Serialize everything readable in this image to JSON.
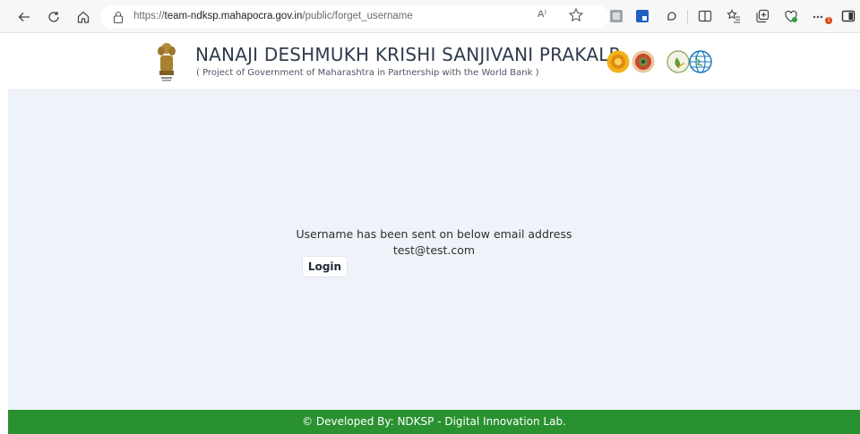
{
  "browser": {
    "url_prefix": "https://",
    "url_host": "team-ndksp.mahapocra.gov.in",
    "url_path": "/public/forget_username",
    "read_aloud": "A⁾",
    "notification_badge": "1"
  },
  "header": {
    "title": "NANAJI DESHMUKH KRISHI SANJIVANI PRAKALP",
    "subtitle": "( Project of Government of Maharashtra in Partnership with the World Bank )"
  },
  "main": {
    "message": "Username has been sent on below email address",
    "email": "test@test.com",
    "login_label": "Login"
  },
  "footer": {
    "text": "© Developed By: NDKSP - Digital Innovation Lab."
  },
  "colors": {
    "footer_bg": "#2a9131",
    "main_bg": "#eef2f9",
    "title_text": "#2f3b4c"
  }
}
